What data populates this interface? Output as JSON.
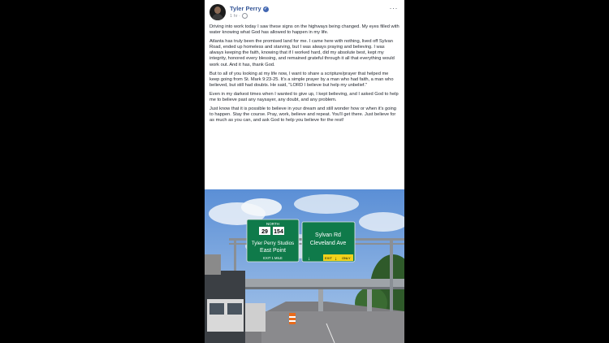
{
  "post": {
    "author": "Tyler Perry",
    "verified_icon": "verified-badge-icon",
    "timestamp": "1 hr",
    "privacy_icon": "globe-icon",
    "more_label": "···",
    "paragraphs": [
      "Driving into work today I saw these signs on the highways being changed. My eyes filled with water knowing what God has allowed to happen in my life.",
      "Atlanta has truly been the promised land for me. I came here with nothing, lived off Sylvan Road, ended up homeless and starving, but I was always praying and believing. I was always keeping the faith, knowing that if I worked hard, did my absolute best, kept my integrity, honored every blessing, and remained grateful through it all that everything would work out. And it has, thank God.",
      "But to all of you looking at my life now, I want to share a scripture/prayer that helped me keep going from St. Mark 9:23-25. It's a simple prayer by a man who had faith, a man who believed, but still had doubts. He said, \"LORD I believe but help my unbelief.\"",
      "Even in my darkest times when I wanted to give up, I kept believing, and I asked God to help me to believe past any naysayer, any doubt, and any problem.",
      "Just know that it is possible to believe in your dream and still wonder how or when it's going to happen. Stay the course. Pray, work, believe and repeat. You'll get there. Just believe for as much as you can, and ask God to help you believe for the rest!"
    ]
  },
  "photo": {
    "sign_left": {
      "direction": "NORTH",
      "route_1": "29",
      "route_2": "154",
      "line_1": "Tyler Perry Studios",
      "line_2": "East Point",
      "exit": "EXIT 1 MILE"
    },
    "sign_right": {
      "line_1": "Sylvan Rd",
      "line_2": "Cleveland Ave",
      "exit_tag": "EXIT",
      "only_tag": "ONLY"
    }
  },
  "colors": {
    "sign_green": "#0f7a4a",
    "link_blue": "#385898"
  }
}
